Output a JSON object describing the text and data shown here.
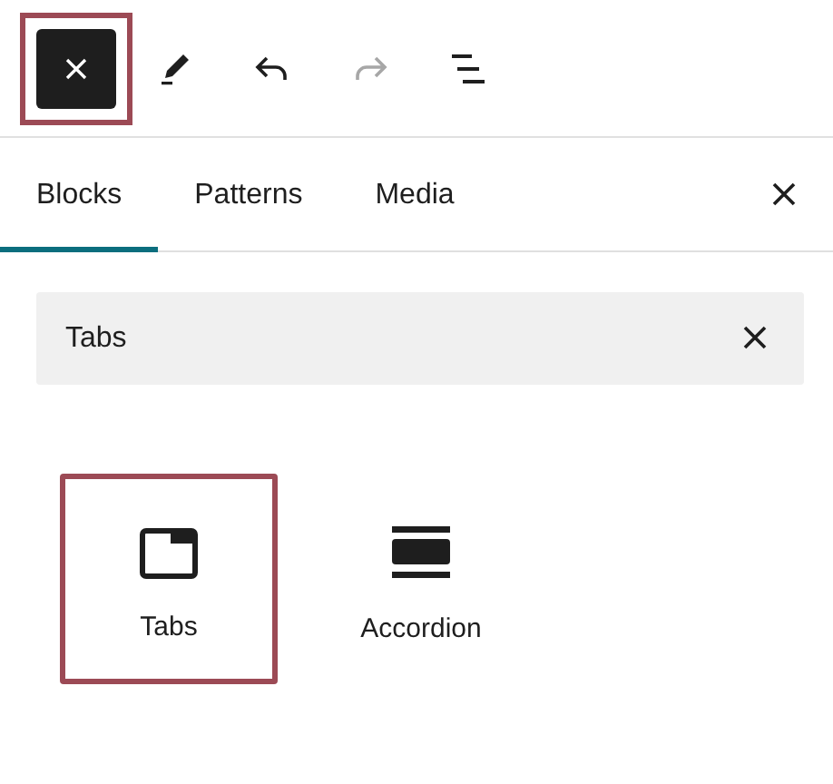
{
  "toolbar": {
    "buttons": [
      {
        "kind": "close",
        "highlighted": true,
        "disabled": false
      },
      {
        "kind": "pencil",
        "highlighted": false,
        "disabled": false
      },
      {
        "kind": "undo",
        "highlighted": false,
        "disabled": false
      },
      {
        "kind": "redo",
        "highlighted": false,
        "disabled": true
      },
      {
        "kind": "outline",
        "highlighted": false,
        "disabled": false
      }
    ]
  },
  "tabs": [
    {
      "label": "Blocks",
      "selected": true
    },
    {
      "label": "Patterns",
      "selected": false
    },
    {
      "label": "Media",
      "selected": false
    }
  ],
  "search": {
    "value": "Tabs"
  },
  "blocks": [
    {
      "label": "Tabs",
      "kind": "tabs",
      "highlighted": true
    },
    {
      "label": "Accordion",
      "kind": "accordion",
      "highlighted": false
    }
  ]
}
